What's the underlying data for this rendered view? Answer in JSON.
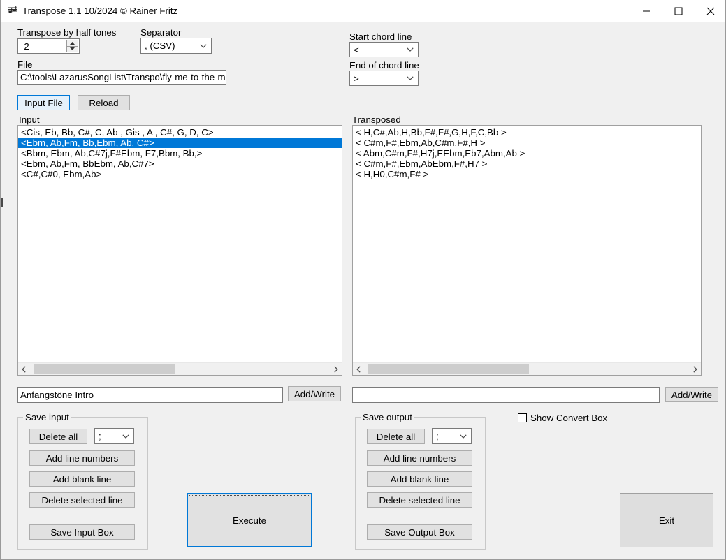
{
  "window": {
    "title": "Transpose 1.1  10/2024 © Rainer Fritz",
    "icon": "music-staff-icon",
    "minimize_label": "minimize-icon",
    "maximize_label": "maximize-icon",
    "close_label": "close-icon",
    "titlebar_bg": "#ffffff",
    "form_bg": "#f0f0f0",
    "accent": "#0078d7"
  },
  "transpose": {
    "label": "Transpose by half tones",
    "value": "-2",
    "up_icon": "spin-up-icon",
    "down_icon": "spin-down-icon"
  },
  "separator": {
    "label": "Separator",
    "value": ",        (CSV)",
    "chevron": "chevron-down-icon"
  },
  "start_chord": {
    "label": "Start chord line",
    "value": "<",
    "chevron": "chevron-down-icon"
  },
  "end_chord": {
    "label": "End of chord line",
    "value": ">",
    "chevron": "chevron-down-icon"
  },
  "file": {
    "label": "File",
    "value": "C:\\tools\\LazarusSongList\\Transpo\\fly-me-to-the-moon"
  },
  "actions": {
    "input_file": "Input File",
    "reload": "Reload",
    "execute": "Execute",
    "exit": "Exit"
  },
  "input_box": {
    "label": "Input",
    "rows": [
      {
        "text": "<Cis, Eb, Bb, C#, C, Ab , Gis , A , C#, G, D, C>",
        "selected": false
      },
      {
        "text": "<Ebm, Ab,Fm, Bb,Ebm, Ab, C#>",
        "selected": true
      },
      {
        "text": "<Bbm, Ebm, Ab,C#7j,F#Ebm, F7,Bbm, Bb,>",
        "selected": false
      },
      {
        "text": "<Ebm, Ab,Fm, BbEbm, Ab,C#7>",
        "selected": false
      },
      {
        "text": "<C#,C#0, Ebm,Ab>",
        "selected": false
      }
    ],
    "scroll_left_icon": "scroll-left-icon",
    "scroll_right_icon": "scroll-right-icon"
  },
  "transposed_box": {
    "label": "Transposed",
    "rows": [
      {
        "text": "< H,C#,Ab,H,Bb,F#,F#,G,H,F,C,Bb >",
        "selected": false
      },
      {
        "text": "< C#m,F#,Ebm,Ab,C#m,F#,H >",
        "selected": false
      },
      {
        "text": "< Abm,C#m,F#,H7j,EEbm,Eb7,Abm,Ab >",
        "selected": false
      },
      {
        "text": "< C#m,F#,Ebm,AbEbm,F#,H7 >",
        "selected": false
      },
      {
        "text": "< H,H0,C#m,F# >",
        "selected": false
      }
    ],
    "scroll_left_icon": "scroll-left-icon",
    "scroll_right_icon": "scroll-right-icon"
  },
  "input_append": {
    "value": "Anfangstöne Intro",
    "placeholder": "",
    "button": "Add/Write"
  },
  "output_append": {
    "value": "",
    "placeholder": "",
    "button": "Add/Write"
  },
  "save_input": {
    "title": "Save input",
    "delete_all": "Delete all",
    "separator_value": ";",
    "separator_chevron": "chevron-down-icon",
    "add_line_numbers": "Add line numbers",
    "add_blank_line": "Add blank line",
    "delete_selected_line": "Delete selected line",
    "save_box": "Save Input Box"
  },
  "save_output": {
    "title": "Save output",
    "delete_all": "Delete all",
    "separator_value": ";",
    "separator_chevron": "chevron-down-icon",
    "add_line_numbers": "Add line numbers",
    "add_blank_line": "Add blank line",
    "delete_selected_line": "Delete selected line",
    "save_box": "Save Output Box"
  },
  "show_convert": {
    "label": "Show Convert Box",
    "checked": false
  }
}
